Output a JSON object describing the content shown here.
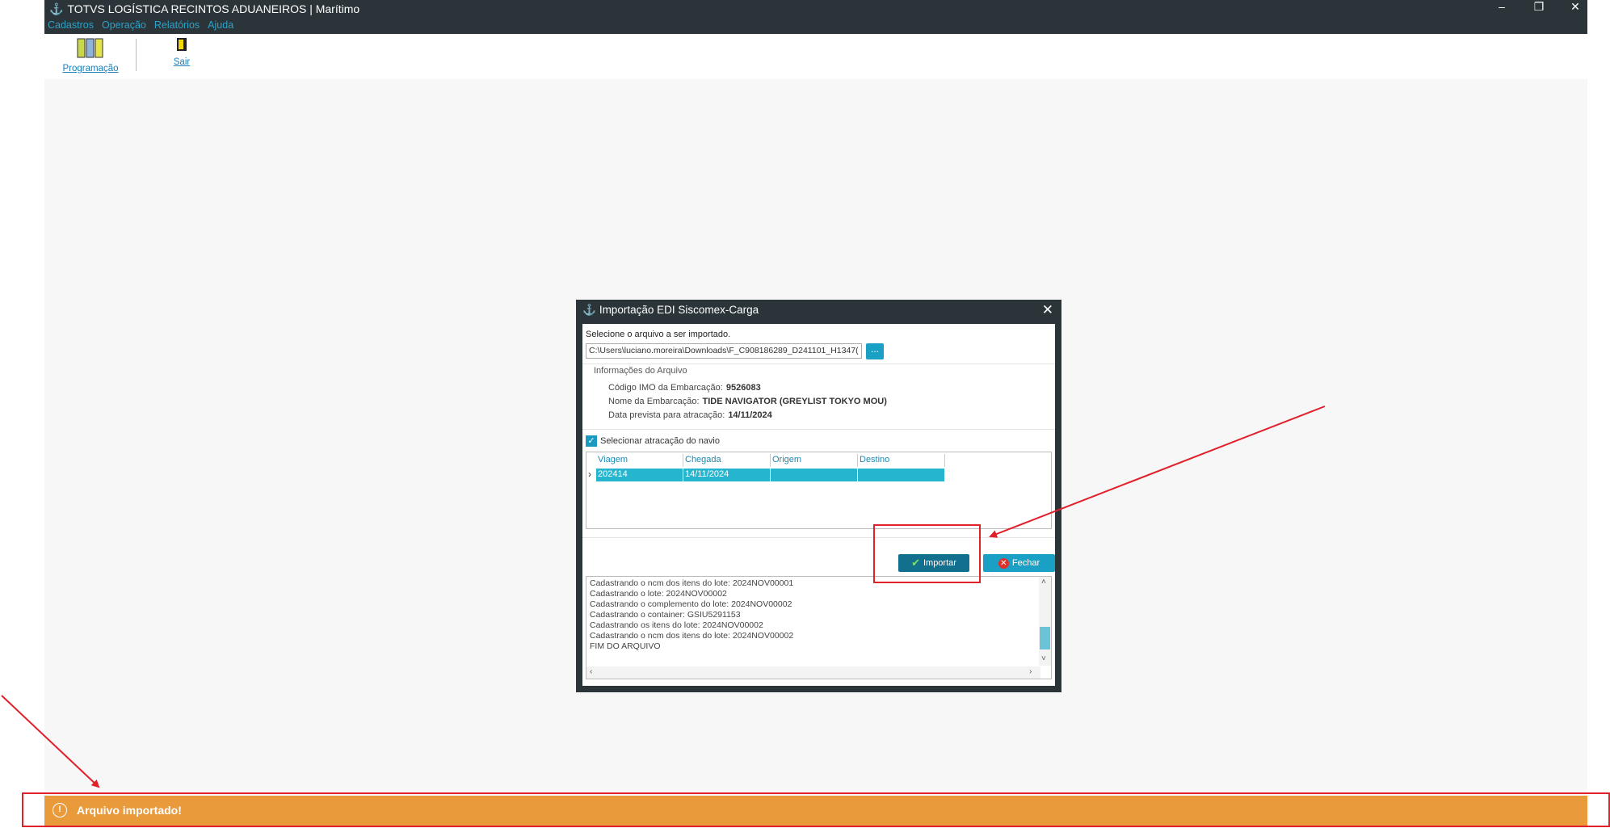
{
  "app": {
    "title": "TOTVS LOGÍSTICA RECINTOS ADUANEIROS | Marítimo",
    "menu": [
      "Cadastros",
      "Operação",
      "Relatórios",
      "Ajuda"
    ],
    "toolbar": {
      "programacao_label": "Programação",
      "sair_label": "Sair"
    }
  },
  "dialog": {
    "title": "Importação EDI Siscomex-Carga",
    "select_file_label": "Selecione o arquivo a ser importado.",
    "file_path": "C:\\Users\\luciano.moreira\\Downloads\\F_C908186289_D241101_H1347(",
    "browse_label": "...",
    "info_legend": "Informações do Arquivo",
    "info": {
      "imo_label": "Código IMO da Embarcação:",
      "imo_value": "9526083",
      "name_label": "Nome da Embarcação:",
      "name_value": "TIDE NAVIGATOR (GREYLIST TOKYO MOU)",
      "date_label": "Data prevista para atracação:",
      "date_value": "14/11/2024"
    },
    "checkbox_label": "Selecionar atracação do navio",
    "grid": {
      "headers": [
        "Viagem",
        "Chegada",
        "Origem",
        "Destino"
      ],
      "row": [
        "202414",
        "14/11/2024",
        "",
        ""
      ]
    },
    "import_label": "Importar",
    "close_label": "Fechar",
    "log": [
      "Cadastrando o ncm dos itens do lote: 2024NOV00001",
      "Cadastrando o lote: 2024NOV00002",
      "Cadastrando o complemento do lote: 2024NOV00002",
      "Cadastrando o container: GSIU5291153",
      "Cadastrando os itens do lote: 2024NOV00002",
      "Cadastrando o ncm dos itens do lote: 2024NOV00002",
      "FIM DO ARQUIVO"
    ]
  },
  "toast": {
    "message": "Arquivo importado!"
  },
  "colors": {
    "titlebar": "#2b3539",
    "accent": "#19a0c4",
    "toast": "#e99a3b",
    "annotation": "#e0202a"
  }
}
